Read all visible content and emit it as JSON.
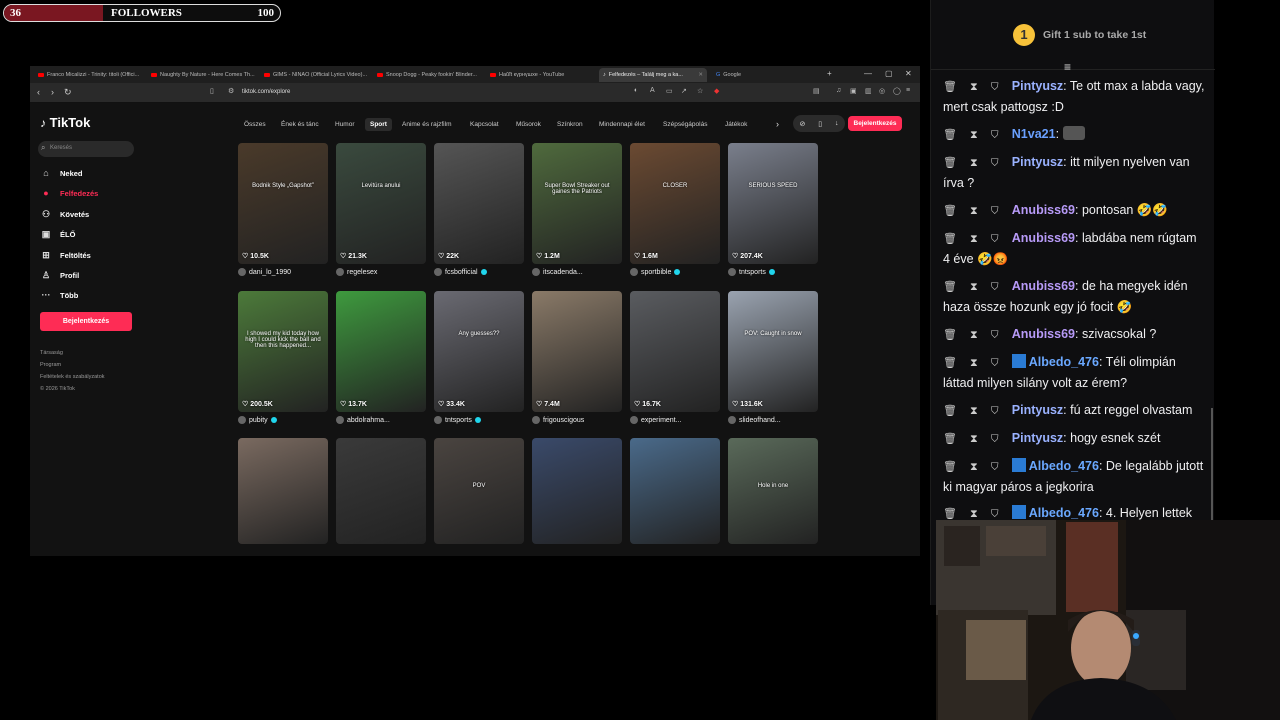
{
  "overlay": {
    "followers_current": "36",
    "followers_label": "FOLLOWERS",
    "followers_goal": "100",
    "progress_fraction": 0.36
  },
  "browser": {
    "tabs": [
      {
        "label": "Franco Micalizzi - Trinity: titoli (Offici..."
      },
      {
        "label": "Naughty By Nature - Here Comes Th..."
      },
      {
        "label": "GIMS - NINAO (Official Lyrics Video)..."
      },
      {
        "label": "Snoop Dogg - Peaky fookin' Blinder..."
      },
      {
        "label": "Наŭĭt күрнүшхе - YouTube"
      },
      {
        "label": "Felfedezés – Találj meg a ka..."
      },
      {
        "label": "Google"
      }
    ],
    "url": "tiktok.com/explore"
  },
  "tiktok": {
    "logo": "TikTok",
    "search_placeholder": "Keresés",
    "menu": [
      {
        "label": "Neked",
        "icon": "home-icon"
      },
      {
        "label": "Felfedezés",
        "icon": "compass-icon"
      },
      {
        "label": "Követés",
        "icon": "following-icon"
      },
      {
        "label": "ÉLŐ",
        "icon": "live-icon"
      },
      {
        "label": "Feltöltés",
        "icon": "upload-icon"
      },
      {
        "label": "Profil",
        "icon": "profile-icon"
      },
      {
        "label": "Több",
        "icon": "more-icon"
      }
    ],
    "login": "Bejelentkezés",
    "footer": [
      "Társaság",
      "Program",
      "Feltételek és szabályzatok",
      "© 2026 TikTok"
    ],
    "categories": [
      "Összes",
      "Ének és tánc",
      "Humor",
      "Sport",
      "Anime és rajzfilm",
      "Kapcsolat",
      "Műsorok",
      "Színkron",
      "Mindennapi élet",
      "Szépségápolás",
      "Játékok"
    ],
    "active_category": "Sport",
    "videos": [
      {
        "views": "10.5K",
        "author": "dani_lo_1990",
        "verified": false,
        "overlay": "Bodnik Style „Gapshot”",
        "bg": "#4a3a2a"
      },
      {
        "views": "21.3K",
        "author": "regelesex",
        "verified": false,
        "overlay": "Levitúra anului",
        "bg": "#3a4a3e"
      },
      {
        "views": "22K",
        "author": "fcsbofficial",
        "verified": true,
        "overlay": "",
        "bg": "#555"
      },
      {
        "views": "1.2M",
        "author": "itscadenda...",
        "verified": false,
        "overlay": "Super Bowl Streaker out gaines the Patriots",
        "bg": "#4f6a3d"
      },
      {
        "views": "1.6M",
        "author": "sportbible",
        "verified": true,
        "overlay": "CLOSER",
        "bg": "#6b4a32"
      },
      {
        "views": "207.4K",
        "author": "tntsports",
        "verified": true,
        "overlay": "SERIOUS SPEED",
        "bg": "#7a7f8c"
      },
      {
        "views": "200.5K",
        "author": "pubity",
        "verified": true,
        "overlay": "I showed my kid today how high I could kick the ball and then this happened...",
        "bg": "#4c7a3a"
      },
      {
        "views": "13.7K",
        "author": "abdolrahma...",
        "verified": false,
        "overlay": "",
        "bg": "#3e9a3e"
      },
      {
        "views": "33.4K",
        "author": "tntsports",
        "verified": true,
        "overlay": "Any guesses??",
        "bg": "#6a6a72"
      },
      {
        "views": "7.4M",
        "author": "frigouscigous",
        "verified": false,
        "overlay": "",
        "bg": "#8a7a68"
      },
      {
        "views": "16.7K",
        "author": "experiment...",
        "verified": false,
        "overlay": "",
        "bg": "#5a5c60"
      },
      {
        "views": "131.6K",
        "author": "slideofhand...",
        "verified": false,
        "overlay": "POV: Caught in snow",
        "bg": "#9aa3b0"
      },
      {
        "views": "",
        "author": "",
        "verified": false,
        "overlay": "",
        "bg": "#7a6a60"
      },
      {
        "views": "",
        "author": "",
        "verified": false,
        "overlay": "",
        "bg": "#3a3a3a"
      },
      {
        "views": "",
        "author": "",
        "verified": false,
        "overlay": "POV",
        "bg": "#4a4440"
      },
      {
        "views": "",
        "author": "",
        "verified": false,
        "overlay": "",
        "bg": "#3a4a6a"
      },
      {
        "views": "",
        "author": "",
        "verified": false,
        "overlay": "",
        "bg": "#4a6a8a"
      },
      {
        "views": "",
        "author": "",
        "verified": false,
        "overlay": "Hole in one",
        "bg": "#5a6a5a"
      }
    ]
  },
  "chat": {
    "gift_text": "Gift 1 sub to take 1st",
    "gift_rank": "1",
    "messages": [
      {
        "user": "Pintyusz",
        "color": "#9ab2ff",
        "text": "Te ott max a labda vagy, mert csak pattogsz :D",
        "avatar": false
      },
      {
        "user": "N1va21",
        "color": "#6aa0ff",
        "text": "",
        "avatar": false,
        "emote": true
      },
      {
        "user": "Pintyusz",
        "color": "#9ab2ff",
        "text": "itt milyen nyelven van írva ?",
        "avatar": false
      },
      {
        "user": "Anubiss69",
        "color": "#b79af7",
        "text": "pontosan 🤣🤣",
        "avatar": false
      },
      {
        "user": "Anubiss69",
        "color": "#b79af7",
        "text": "labdába nem rúgtam 4 éve 🤣😡",
        "avatar": false
      },
      {
        "user": "Anubiss69",
        "color": "#b79af7",
        "text": "de ha megyek idén haza össze hozunk egy jó focit 🤣",
        "avatar": false
      },
      {
        "user": "Anubiss69",
        "color": "#b79af7",
        "text": "szivacsokal ?",
        "avatar": false
      },
      {
        "user": "Albedo_476",
        "color": "#6aa8ff",
        "text": "Téli olimpián láttad milyen silány volt az érem?",
        "avatar": true
      },
      {
        "user": "Pintyusz",
        "color": "#9ab2ff",
        "text": "fú azt reggel olvastam",
        "avatar": false
      },
      {
        "user": "Pintyusz",
        "color": "#9ab2ff",
        "text": "hogy esnek szét",
        "avatar": false
      },
      {
        "user": "Albedo_476",
        "color": "#6aa8ff",
        "text": "De legalább jutott ki magyar páros a jegkorira",
        "avatar": true
      },
      {
        "user": "Albedo_476",
        "color": "#6aa8ff",
        "text": "4. Helyen lettek",
        "avatar": true
      }
    ]
  },
  "accent": {
    "tiktok_red": "#fe2c55",
    "twitch_coin": "#f7c23a"
  }
}
